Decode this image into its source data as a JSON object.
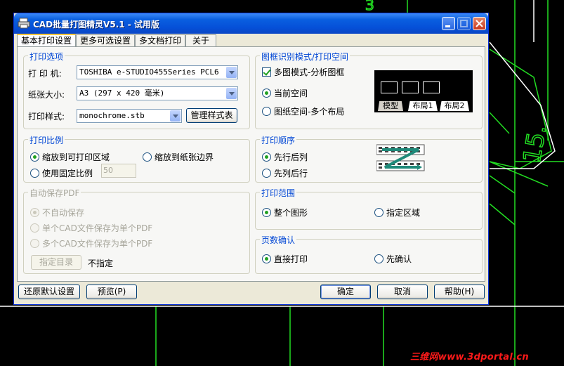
{
  "window": {
    "title": "CAD批量打图精灵V5.1 - 试用版"
  },
  "tabs": [
    "基本打印设置",
    "更多可选设置",
    "多文档打印",
    "关于"
  ],
  "print_options": {
    "group_label": "打印选项",
    "printer_label": "打 印 机:",
    "printer_value": "TOSHIBA e-STUDIO455Series PCL6",
    "paper_label": "纸张大小:",
    "paper_value": "A3 (297 x 420 毫米)",
    "style_label": "打印样式:",
    "style_value": "monochrome.stb",
    "manage_button": "管理样式表"
  },
  "frame_mode": {
    "group_label": "图框识别模式/打印空间",
    "multi_frame_label": "多图模式-分析图框",
    "multi_frame_checked": true,
    "current_space_label": "当前空间",
    "paper_space_label": "图纸空间-多个布局",
    "preview_tabs": [
      "模型",
      "布局1",
      "布局2"
    ]
  },
  "scale": {
    "group_label": "打印比例",
    "fit_printable_label": "缩放到可打印区域",
    "fit_paper_label": "缩放到纸张边界",
    "fixed_label": "使用固定比例",
    "fixed_value": "50"
  },
  "order": {
    "group_label": "打印顺序",
    "row_first_label": "先行后列",
    "col_first_label": "先列后行"
  },
  "auto_pdf": {
    "group_label": "自动保存PDF",
    "no_save_label": "不自动保存",
    "single_label": "单个CAD文件保存为单个PDF",
    "multi_label": "多个CAD文件保存为单个PDF",
    "dir_button": "指定目录",
    "dir_value": "不指定"
  },
  "range": {
    "group_label": "打印范围",
    "whole_label": "整个图形",
    "area_label": "指定区域"
  },
  "page_confirm": {
    "group_label": "页数确认",
    "direct_label": "直接打印",
    "confirm_label": "先确认"
  },
  "buttons": {
    "restore": "还原默认设置",
    "preview": "预览(P)",
    "ok": "确定",
    "cancel": "取消",
    "help": "帮助(H)"
  },
  "background": {
    "cad_labels": [
      "15.",
      "3"
    ],
    "watermark": "三维网www.3dportal.cn"
  },
  "colors": {
    "title_bar": "#0a5fe0",
    "group_label": "#0046d5",
    "cad_lines": "#22dd22",
    "watermark": "#ff1a1a"
  }
}
